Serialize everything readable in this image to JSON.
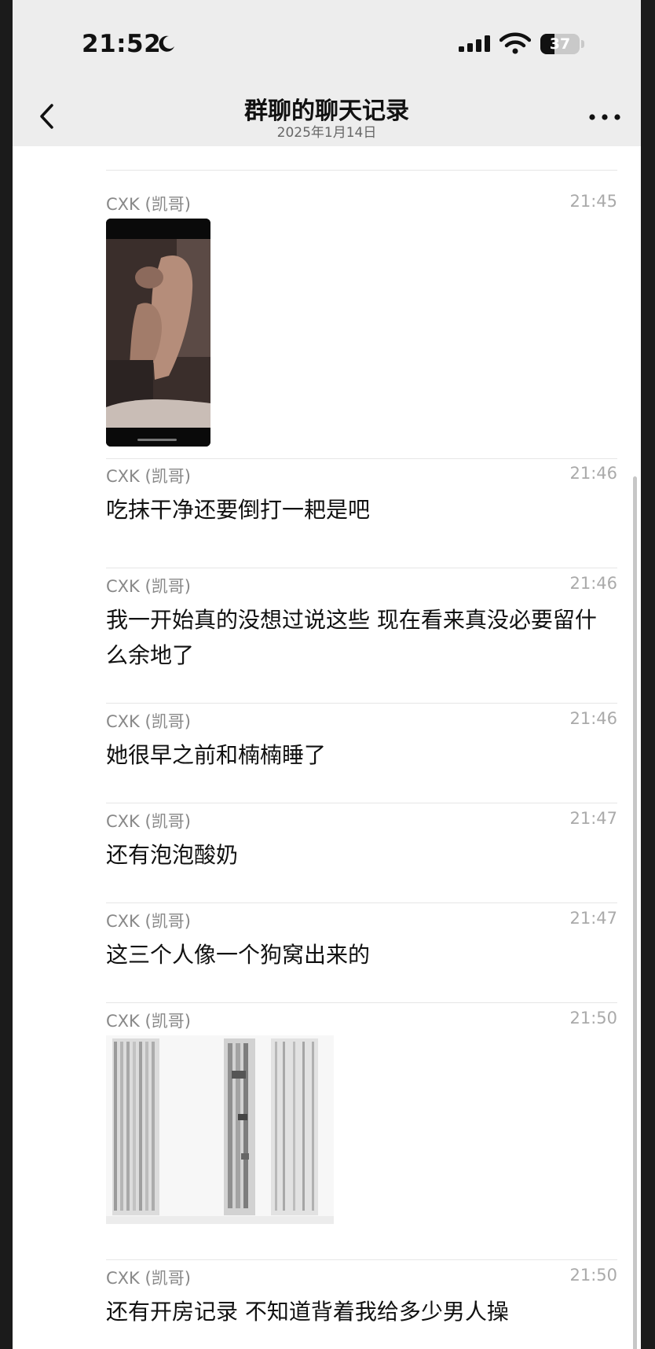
{
  "status_bar": {
    "time": "21:52",
    "battery": "37"
  },
  "nav": {
    "title": "群聊的聊天记录",
    "subtitle": "2025年1月14日"
  },
  "messages": [
    {
      "sender": "CXK (凯哥)",
      "time": "21:45",
      "type": "video"
    },
    {
      "sender": "CXK (凯哥)",
      "time": "21:46",
      "text": "吃抹干净还要倒打一耙是吧"
    },
    {
      "sender": "CXK (凯哥)",
      "time": "21:46",
      "text": "我一开始真的没想过说这些 现在看来真没必要留什么余地了"
    },
    {
      "sender": "CXK (凯哥)",
      "time": "21:46",
      "text": "她很早之前和楠楠睡了"
    },
    {
      "sender": "CXK (凯哥)",
      "time": "21:47",
      "text": "还有泡泡酸奶"
    },
    {
      "sender": "CXK (凯哥)",
      "time": "21:47",
      "text": "这三个人像一个狗窝出来的"
    },
    {
      "sender": "CXK (凯哥)",
      "time": "21:50",
      "type": "image"
    },
    {
      "sender": "CXK (凯哥)",
      "time": "21:50",
      "text": "还有开房记录 不知道背着我给多少男人操"
    }
  ],
  "colors": {
    "header_bg": "#ededed",
    "page_bg": "#ffffff",
    "sender": "#888888",
    "timestamp": "#aaaaaa",
    "text": "#111111",
    "divider": "#e6e6e6"
  },
  "icons": [
    "moon-icon",
    "signal-icon",
    "wifi-icon",
    "battery-icon",
    "back-chevron-icon",
    "more-icon"
  ]
}
